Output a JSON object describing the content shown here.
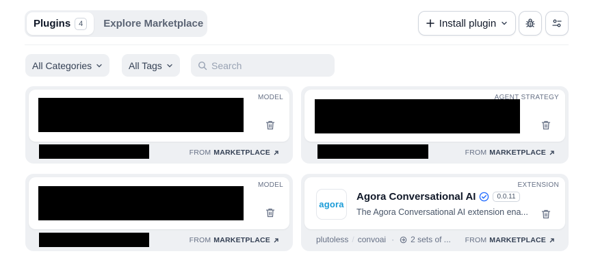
{
  "header": {
    "tab_plugins": "Plugins",
    "plugin_count": "4",
    "tab_marketplace": "Explore Marketplace",
    "install_label": "Install plugin"
  },
  "filters": {
    "categories": "All Categories",
    "tags": "All Tags",
    "search_placeholder": "Search"
  },
  "cards": [
    {
      "tag": "MODEL",
      "from_prefix": "FROM",
      "from_source": "MARKETPLACE"
    },
    {
      "tag": "AGENT STRATEGY",
      "from_prefix": "FROM",
      "from_source": "MARKETPLACE"
    },
    {
      "tag": "MODEL",
      "from_prefix": "FROM",
      "from_source": "MARKETPLACE"
    },
    {
      "tag": "EXTENSION",
      "logo_text": "agora",
      "title": "Agora Conversational AI",
      "version": "0.0.11",
      "description": "The Agora Conversational AI extension ena...",
      "org": "plutoless",
      "repo": "convoai",
      "endpoints": "2 sets of ...",
      "from_prefix": "FROM",
      "from_source": "MARKETPLACE"
    }
  ],
  "colors": {
    "verified": "#2970ff",
    "agora_brand": "#1a9bd7",
    "surface": "#eef0f3"
  },
  "icons": [
    "plus-icon",
    "chevron-down-icon",
    "debug-icon",
    "settings-sliders-icon",
    "search-icon",
    "trash-icon",
    "arrow-up-right-icon",
    "verified-icon",
    "endpoint-icon"
  ]
}
